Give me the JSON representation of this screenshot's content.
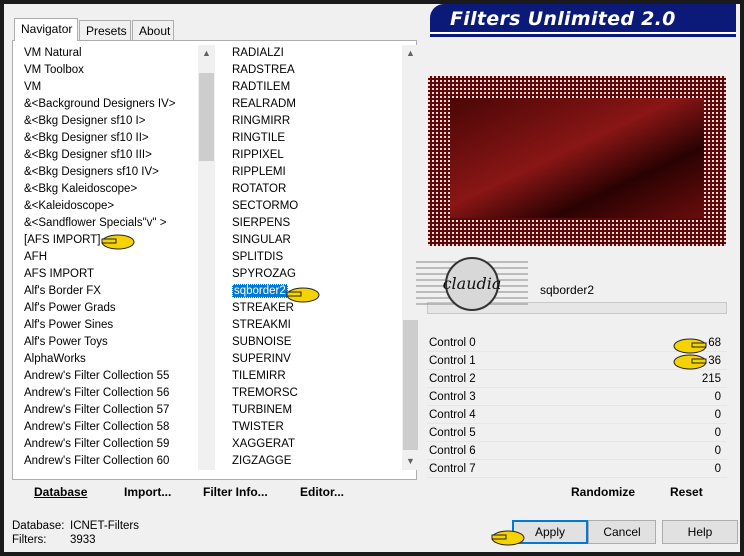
{
  "app": {
    "title": "Filters Unlimited 2.0"
  },
  "tabs": [
    {
      "label": "Navigator",
      "active": true
    },
    {
      "label": "Presets",
      "active": false
    },
    {
      "label": "About",
      "active": false
    }
  ],
  "categories": [
    "VM Natural",
    "VM Toolbox",
    "VM",
    "&<Background Designers IV>",
    "&<Bkg Designer sf10 I>",
    "&<Bkg Designer sf10 II>",
    "&<Bkg Designer sf10 III>",
    "&<Bkg Designers sf10 IV>",
    "&<Bkg Kaleidoscope>",
    "&<Kaleidoscope>",
    "&<Sandflower Specials\"v\" >",
    "[AFS IMPORT]",
    "AFH",
    "AFS IMPORT",
    "Alf's Border FX",
    "Alf's Power Grads",
    "Alf's Power Sines",
    "Alf's Power Toys",
    "AlphaWorks",
    "Andrew's Filter Collection 55",
    "Andrew's Filter Collection 56",
    "Andrew's Filter Collection 57",
    "Andrew's Filter Collection 58",
    "Andrew's Filter Collection 59",
    "Andrew's Filter Collection 60"
  ],
  "filters": [
    "RADIALZI",
    "RADSTREA",
    "RADTILEM",
    "REALRADM",
    "RINGMIRR",
    "RINGTILE",
    "RIPPIXEL",
    "RIPPLEMI",
    "ROTATOR",
    "SECTORMO",
    "SIERPENS",
    "SINGULAR",
    "SPLITDIS",
    "SPYROZAG",
    "sqborder2",
    "STREAKER",
    "STREAKMI",
    "SUBNOISE",
    "SUPERINV",
    "TILEMIRR",
    "TREMORSC",
    "TURBINEM",
    "TWISTER",
    "XAGGERAT",
    "ZIGZAGGE"
  ],
  "selected_filter": "sqborder2",
  "filter_name": "sqborder2",
  "logo_text": "claudia",
  "controls": [
    {
      "label": "Control 0",
      "value": "68"
    },
    {
      "label": "Control 1",
      "value": "36"
    },
    {
      "label": "Control 2",
      "value": "215"
    },
    {
      "label": "Control 3",
      "value": "0"
    },
    {
      "label": "Control 4",
      "value": "0"
    },
    {
      "label": "Control 5",
      "value": "0"
    },
    {
      "label": "Control 6",
      "value": "0"
    },
    {
      "label": "Control 7",
      "value": "0"
    }
  ],
  "toolbar": {
    "database": "Database",
    "import": "Import...",
    "filter_info": "Filter Info...",
    "editor": "Editor...",
    "randomize": "Randomize",
    "reset": "Reset"
  },
  "status": {
    "database_label": "Database:",
    "database_value": "ICNET-Filters",
    "filters_label": "Filters:",
    "filters_value": "3933"
  },
  "buttons": {
    "apply": "Apply",
    "cancel": "Cancel",
    "help": "Help"
  },
  "colors": {
    "preview_red": "#7a1212",
    "selection_blue": "#0078d7",
    "banner_blue": "#0b1a78",
    "pointer_yellow": "#f5d300"
  },
  "icons": [
    "pointing-hand-icon",
    "scroll-up-icon",
    "scroll-down-icon"
  ]
}
